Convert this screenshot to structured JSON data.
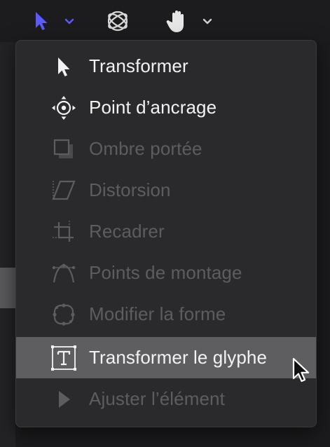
{
  "toolbar": {
    "select_tool_icon": "arrow-pointer-icon",
    "select_tool_chevron": "chevron-down-icon",
    "orbit_tool_icon": "3d-orbit-icon",
    "pan_tool_icon": "hand-icon",
    "pan_tool_chevron": "chevron-down-icon",
    "accent_color": "#5b5bff"
  },
  "menu": {
    "items": [
      {
        "label": "Transformer",
        "icon": "arrow-pointer-icon",
        "enabled": true
      },
      {
        "label": "Point d’ancrage",
        "icon": "anchor-point-icon",
        "enabled": true
      },
      {
        "label": "Ombre portée",
        "icon": "drop-shadow-icon",
        "enabled": false
      },
      {
        "label": "Distorsion",
        "icon": "distort-icon",
        "enabled": false
      },
      {
        "label": "Recadrer",
        "icon": "crop-icon",
        "enabled": false
      },
      {
        "label": "Points de montage",
        "icon": "edit-points-icon",
        "enabled": false
      },
      {
        "label": "Modifier la forme",
        "icon": "edit-shape-icon",
        "enabled": false
      },
      {
        "label": "Transformer le glyphe",
        "icon": "transform-glyph-icon",
        "enabled": true,
        "highlighted": true
      },
      {
        "label": "Ajuster l’élément",
        "icon": "adjust-item-icon",
        "enabled": false
      }
    ]
  }
}
